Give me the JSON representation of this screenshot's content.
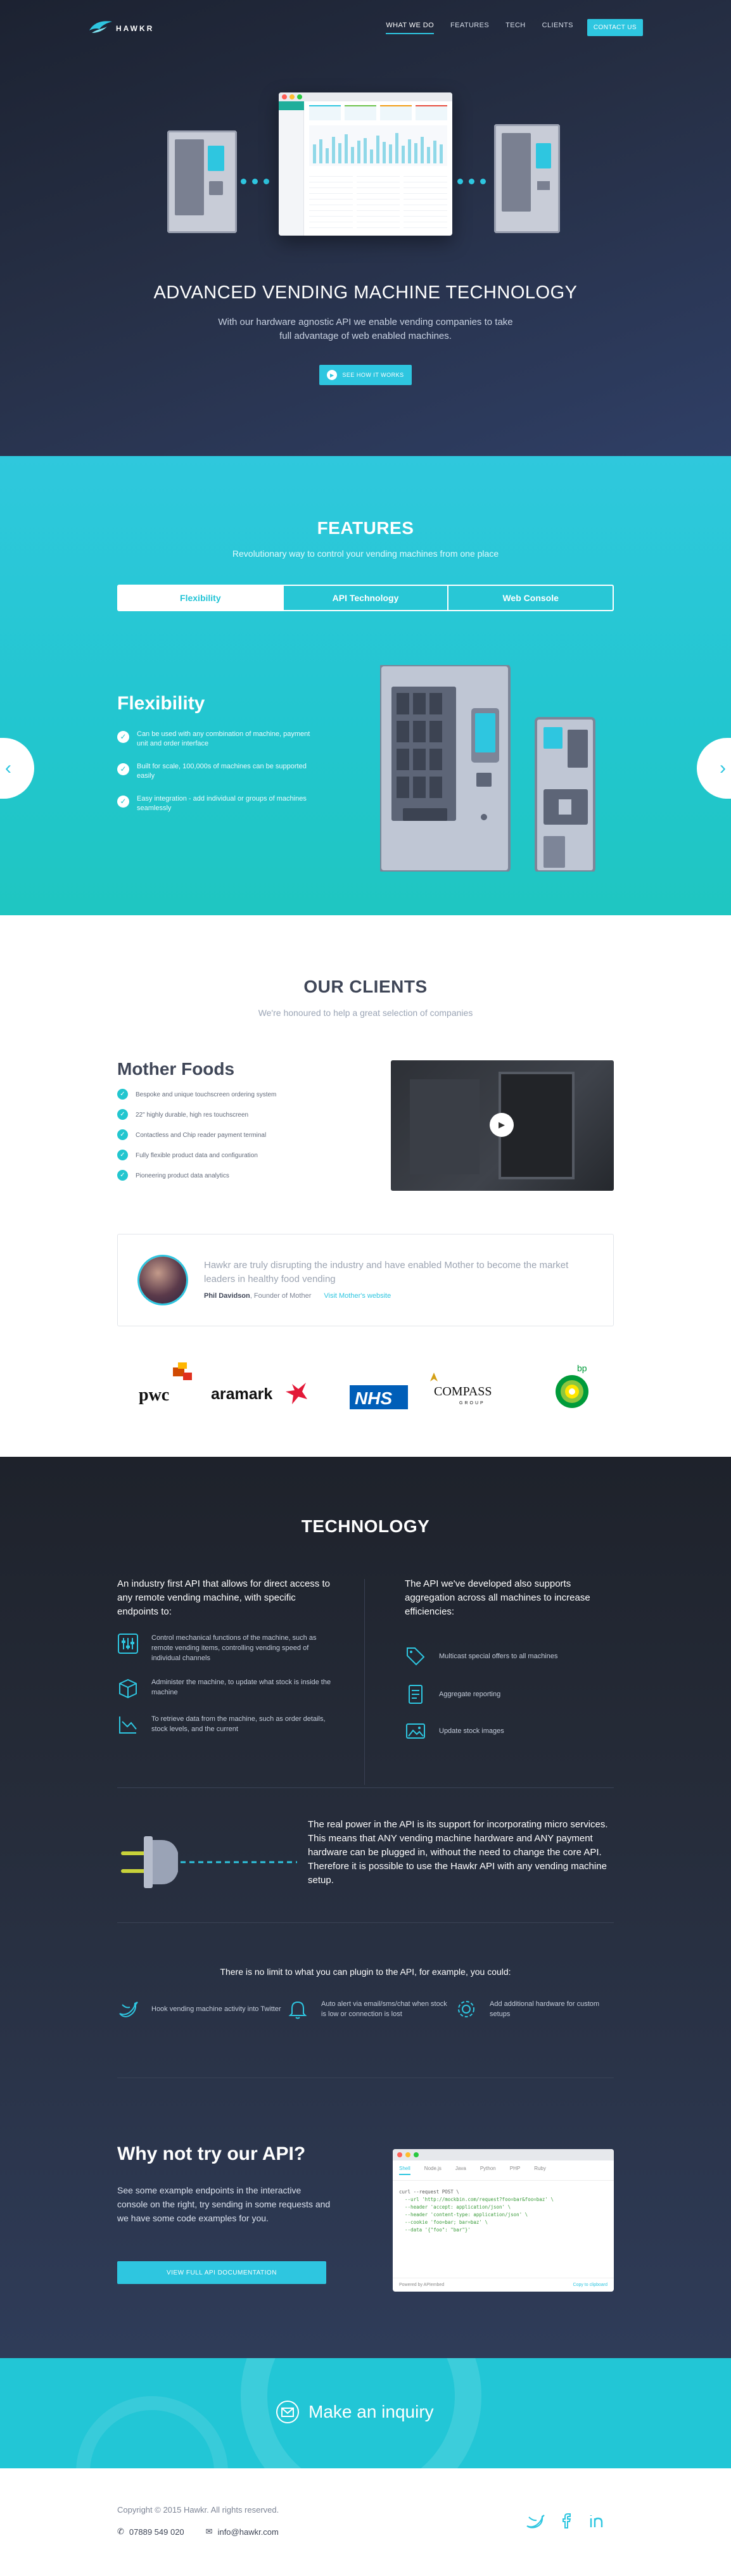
{
  "nav": {
    "logo_text": "HAWKR",
    "items": [
      {
        "label": "WHAT WE DO",
        "active": true
      },
      {
        "label": "FEATURES",
        "active": false
      },
      {
        "label": "TECH",
        "active": false
      },
      {
        "label": "CLIENTS",
        "active": false
      }
    ],
    "cta": "CONTACT US"
  },
  "hero": {
    "title": "ADVANCED VENDING MACHINE TECHNOLOGY",
    "subtitle": "With our hardware agnostic API we enable vending companies to take full advantage of web enabled machines.",
    "button": "SEE HOW IT WORKS"
  },
  "features": {
    "title": "FEATURES",
    "subtitle": "Revolutionary way to control your vending machines from one place",
    "tabs": [
      "Flexibility",
      "API Technology",
      "Web Console"
    ],
    "active_tab": "Flexibility",
    "heading": "Flexibility",
    "items": [
      "Can be used with any combination of machine, payment unit and order interface",
      "Built for scale, 100,000s of machines can be supported easily",
      "Easy integration - add individual or groups of machines seamlessly"
    ],
    "prev_icon": "chevron-left-icon",
    "next_icon": "chevron-right-icon"
  },
  "clients": {
    "title": "OUR CLIENTS",
    "subtitle": "We're honoured to help a great selection of companies",
    "client_name": "Mother Foods",
    "items": [
      "Bespoke and unique touchscreen ordering system",
      "22\" highly durable, high res touchscreen",
      "Contactless and Chip reader payment terminal",
      "Fully flexible product data and configuration",
      "Pioneering product data analytics"
    ],
    "quote": "Hawkr are truly disrupting the industry and have enabled Mother to become the market leaders in healthy food vending",
    "person_name": "Phil Davidson",
    "person_role": ", Founder of Mother",
    "link": "Visit Mother's website",
    "logos": [
      "pwc",
      "aramark",
      "NHS",
      "COMPASS",
      "GROUP",
      "bp"
    ]
  },
  "tech": {
    "title": "TECHNOLOGY",
    "left_lead": "An industry first API that allows for direct access to any remote vending machine, with specific endpoints to:",
    "left_items": [
      "Control mechanical functions of the machine, such as remote vending items, controlling vending speed of individual channels",
      "Administer the machine, to update what stock is inside the machine",
      "To retrieve data from the machine, such as order details, stock levels, and the current"
    ],
    "right_lead": "The API we've developed also supports aggregation across all machines to increase efficiencies:",
    "right_items": [
      "Multicast special offers to all machines",
      "Aggregate reporting",
      "Update stock images"
    ],
    "plug_text": "The real power in the API is its support for incorporating micro services. This means that ANY vending machine hardware and ANY payment hardware can be plugged in, without the need to change the core API. Therefore it is possible to use the Hawkr API with any vending machine setup.",
    "plugin_lead": "There is no limit to what you can plugin to the API, for example, you could:",
    "plugin_items": [
      "Hook vending machine activity into Twitter",
      "Auto alert via email/sms/chat when stock is low or connection is lost",
      "Add additional hardware for custom setups"
    ],
    "api_title": "Why not try our API?",
    "api_text": "See some example endpoints in the interactive console on the right, try sending in some requests and we have some code examples for you.",
    "api_button": "VIEW FULL API DOCUMENTATION",
    "console": {
      "tabs": [
        "Shell",
        "Node.js",
        "Java",
        "Python",
        "PHP",
        "Ruby"
      ],
      "code_lines": [
        "curl --request POST \\",
        "  --url 'http://mockbin.com/request?foo=bar&foo=baz' \\",
        "  --header 'accept: application/json' \\",
        "  --header 'content-type: application/json' \\",
        "  --cookie 'foo=bar; bar=baz' \\",
        "  --data '{\"foo\": \"bar\"}'"
      ],
      "footer_left": "Powered by APIembed",
      "footer_right": "Copy to clipboard"
    }
  },
  "inquiry": {
    "label": "Make an inquiry"
  },
  "footer": {
    "copyright": "Copyright © 2015 Hawkr. All rights reserved.",
    "phone": "07889 549 020",
    "email": "info@hawkr.com"
  },
  "colors": {
    "accent": "#2ec6e0",
    "teal": "#22c6cf",
    "dark": "#1e222b",
    "navy": "#2f3f66"
  }
}
